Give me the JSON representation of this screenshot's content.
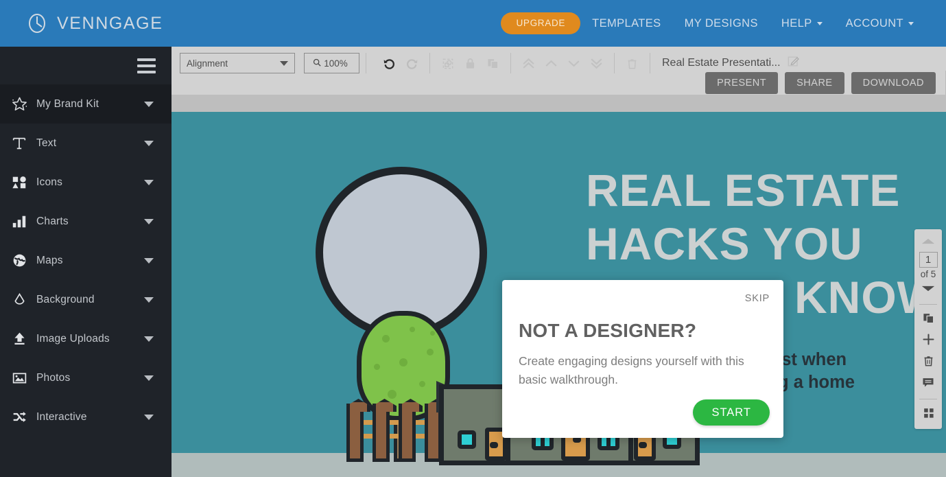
{
  "header": {
    "logo_text": "VENNGAGE",
    "logo_icon": "venngage-clock-icon",
    "upgrade_label": "UPGRADE",
    "nav": [
      {
        "label": "TEMPLATES",
        "caret": false
      },
      {
        "label": "MY DESIGNS",
        "caret": false
      },
      {
        "label": "HELP",
        "caret": true
      },
      {
        "label": "ACCOUNT",
        "caret": true
      }
    ]
  },
  "sidebar": {
    "menu_icon": "hamburger-icon",
    "items": [
      {
        "label": "My Brand Kit",
        "icon": "star-sparkle-icon",
        "active": true
      },
      {
        "label": "Text",
        "icon": "text-t-icon",
        "active": false
      },
      {
        "label": "Icons",
        "icon": "shapes-icon",
        "active": false
      },
      {
        "label": "Charts",
        "icon": "bar-chart-icon",
        "active": false
      },
      {
        "label": "Maps",
        "icon": "globe-icon",
        "active": false
      },
      {
        "label": "Background",
        "icon": "droplet-icon",
        "active": false
      },
      {
        "label": "Image Uploads",
        "icon": "upload-icon",
        "active": false
      },
      {
        "label": "Photos",
        "icon": "picture-icon",
        "active": false
      },
      {
        "label": "Interactive",
        "icon": "shuffle-icon",
        "active": false
      }
    ]
  },
  "toolbar": {
    "alignment_label": "Alignment",
    "zoom_label": "100%",
    "zoom_icon": "magnifier-icon",
    "icons": [
      {
        "name": "undo-icon",
        "enabled": true
      },
      {
        "name": "redo-icon",
        "enabled": false
      },
      {
        "name": "group-icon",
        "enabled": false
      },
      {
        "name": "lock-icon",
        "enabled": false
      },
      {
        "name": "duplicate-icon",
        "enabled": false
      },
      {
        "name": "bring-to-front-icon",
        "enabled": false
      },
      {
        "name": "bring-forward-icon",
        "enabled": false
      },
      {
        "name": "send-backward-icon",
        "enabled": false
      },
      {
        "name": "send-to-back-icon",
        "enabled": false
      },
      {
        "name": "delete-icon",
        "enabled": false
      }
    ],
    "document_title": "Real Estate Presentati...",
    "edit_title_icon": "edit-pencil-icon",
    "present_label": "PRESENT",
    "share_label": "SHARE",
    "download_label": "DOWNLOAD"
  },
  "canvas": {
    "background_color": "#3b8e9c",
    "title": "REAL ESTATE\nHACKS YOU\nSHOULD KNOW",
    "subtitle": "To help you get the most when\nyou’re buying or selling a home",
    "title_color": "#ccd1d1",
    "subtitle_color": "#27333a",
    "illustration": "house-tree-fence-speech-bubble"
  },
  "modal": {
    "skip_label": "SKIP",
    "title": "NOT A DESIGNER?",
    "body": "Create engaging designs yourself with this basic walkthrough.",
    "start_label": "START",
    "start_color": "#2cb742"
  },
  "page_panel": {
    "up_icon": "chevron-up-icon",
    "down_icon": "chevron-down-icon",
    "current_page": "1",
    "total_label": "of 5",
    "buttons": [
      {
        "name": "duplicate-page-icon"
      },
      {
        "name": "add-page-icon"
      },
      {
        "name": "delete-page-icon"
      },
      {
        "name": "comment-icon"
      },
      {
        "name": "grid-view-icon"
      }
    ]
  }
}
